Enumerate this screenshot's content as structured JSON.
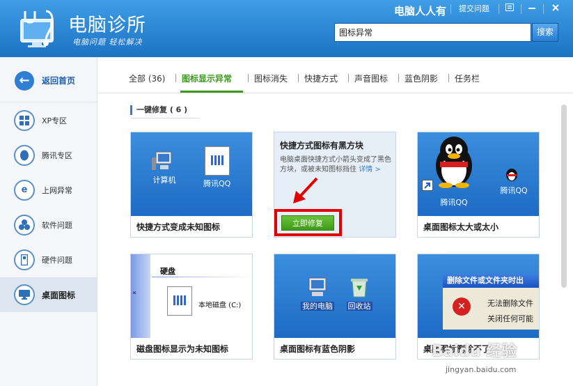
{
  "header": {
    "app_title": "电脑诊所",
    "app_slogan": "电脑问题 轻松解决",
    "brand": "电脑人人有",
    "submit_question": "提交问题",
    "search_value": "图标异常",
    "search_button": "搜索"
  },
  "sidebar": {
    "home": "返回首页",
    "items": [
      {
        "label": "XP专区",
        "icon": "windows-icon"
      },
      {
        "label": "腾讯专区",
        "icon": "qq-icon"
      },
      {
        "label": "上网异常",
        "icon": "ie-icon"
      },
      {
        "label": "软件问题",
        "icon": "software-icon"
      },
      {
        "label": "硬件问题",
        "icon": "hardware-icon"
      },
      {
        "label": "桌面图标",
        "icon": "desktop-icon"
      }
    ]
  },
  "tabs": [
    "全部 (36)",
    "图标显示异常",
    "图标消失",
    "快捷方式",
    "声音图标",
    "蓝色阴影",
    "任务栏"
  ],
  "section_title": "一键修复 ( 6 )",
  "cards": {
    "c1": {
      "title": "快捷方式变成未知图标",
      "icon1": "计算机",
      "icon2": "腾讯QQ"
    },
    "c2": {
      "title": "快捷方式图标有黑方块",
      "desc": "电脑桌面快捷方式小箭头变成了黑色方块，或被未知图标挡住",
      "link": "详情 >",
      "fix": "立即修复"
    },
    "c3": {
      "title": "桌面图标太大或太小",
      "icon1": "腾讯QQ",
      "icon2": "腾讯QQ"
    },
    "c4": {
      "title": "磁盘图标显示为未知图标",
      "header": "硬盘",
      "disk": "本地磁盘 (C:)"
    },
    "c5": {
      "title": "桌面图标有蓝色阴影",
      "icon1": "我的电脑",
      "icon2": "回收站"
    },
    "c6": {
      "title": "桌面图标删除不了",
      "dialog_title": "删除文件或文件夹时出",
      "line1": "无法删除文件",
      "line2": "关闭任何可能"
    }
  },
  "watermark": "Baidu 经验",
  "watermark_url": "jingyan.baidu.com",
  "colors": {
    "header_blue": "#1d72c4",
    "active_green": "#3a9a1a",
    "highlight_red": "#e10000"
  }
}
